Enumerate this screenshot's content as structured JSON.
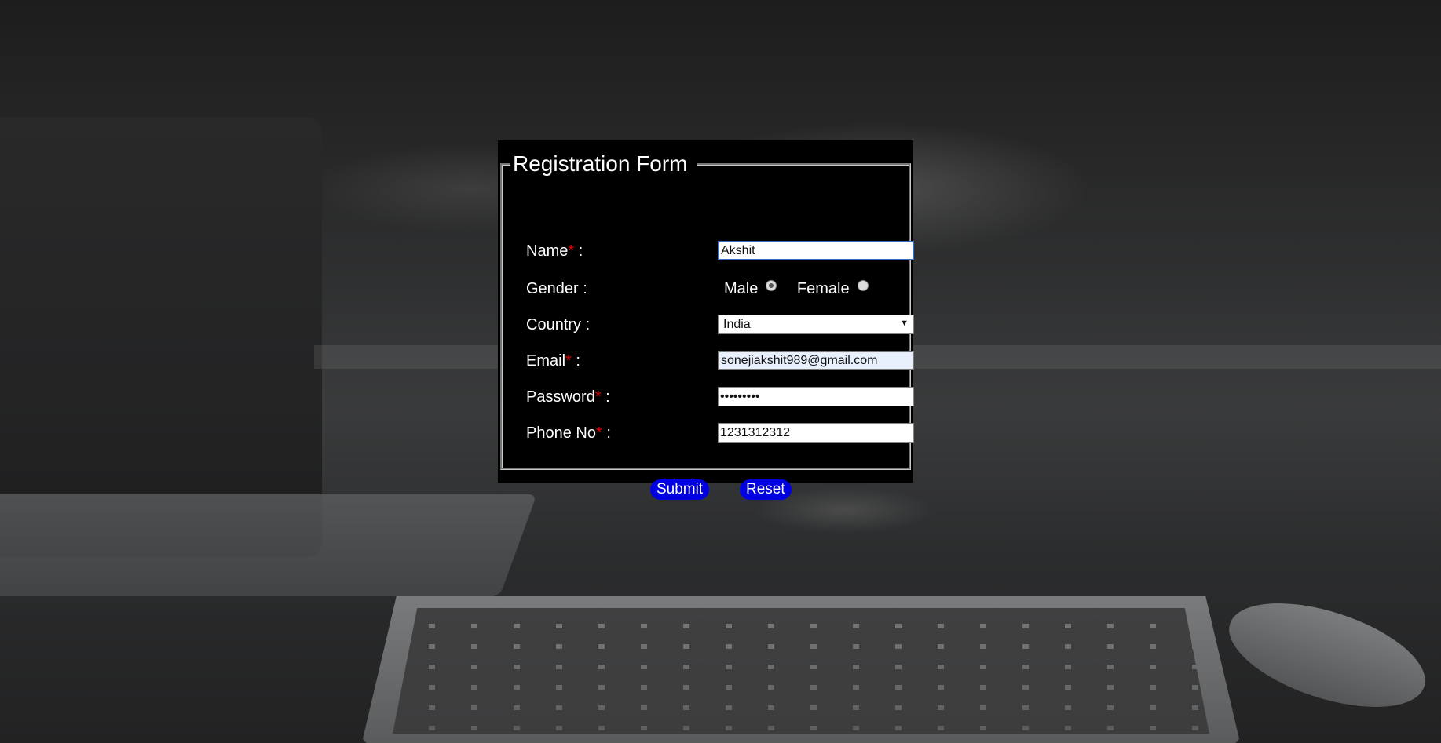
{
  "form": {
    "title": "Registration Form",
    "fields": {
      "name": {
        "label": "Name",
        "required_mark": "*",
        "colon": ":",
        "value": "Akshit"
      },
      "gender": {
        "label": "Gender :",
        "options": [
          "Male",
          "Female"
        ],
        "selected": "Male"
      },
      "country": {
        "label": "Country :",
        "value": "India"
      },
      "email": {
        "label": "Email",
        "required_mark": "*",
        "colon": ":",
        "value": "sonejiakshit989@gmail.com"
      },
      "password": {
        "label": "Password",
        "required_mark": "*",
        "colon": ":",
        "value": "•••••••••"
      },
      "phone": {
        "label": "Phone No",
        "required_mark": "*",
        "colon": ":",
        "value": "1231312312"
      }
    },
    "buttons": {
      "submit": "Submit",
      "reset": "Reset"
    }
  },
  "colors": {
    "panel_bg": "#000000",
    "required_star": "#e00000",
    "button_bg": "#0000e0",
    "button_text": "#ffffff",
    "label_text": "#ffffff"
  },
  "icons": {
    "dropdown": "chevron-down-icon"
  }
}
